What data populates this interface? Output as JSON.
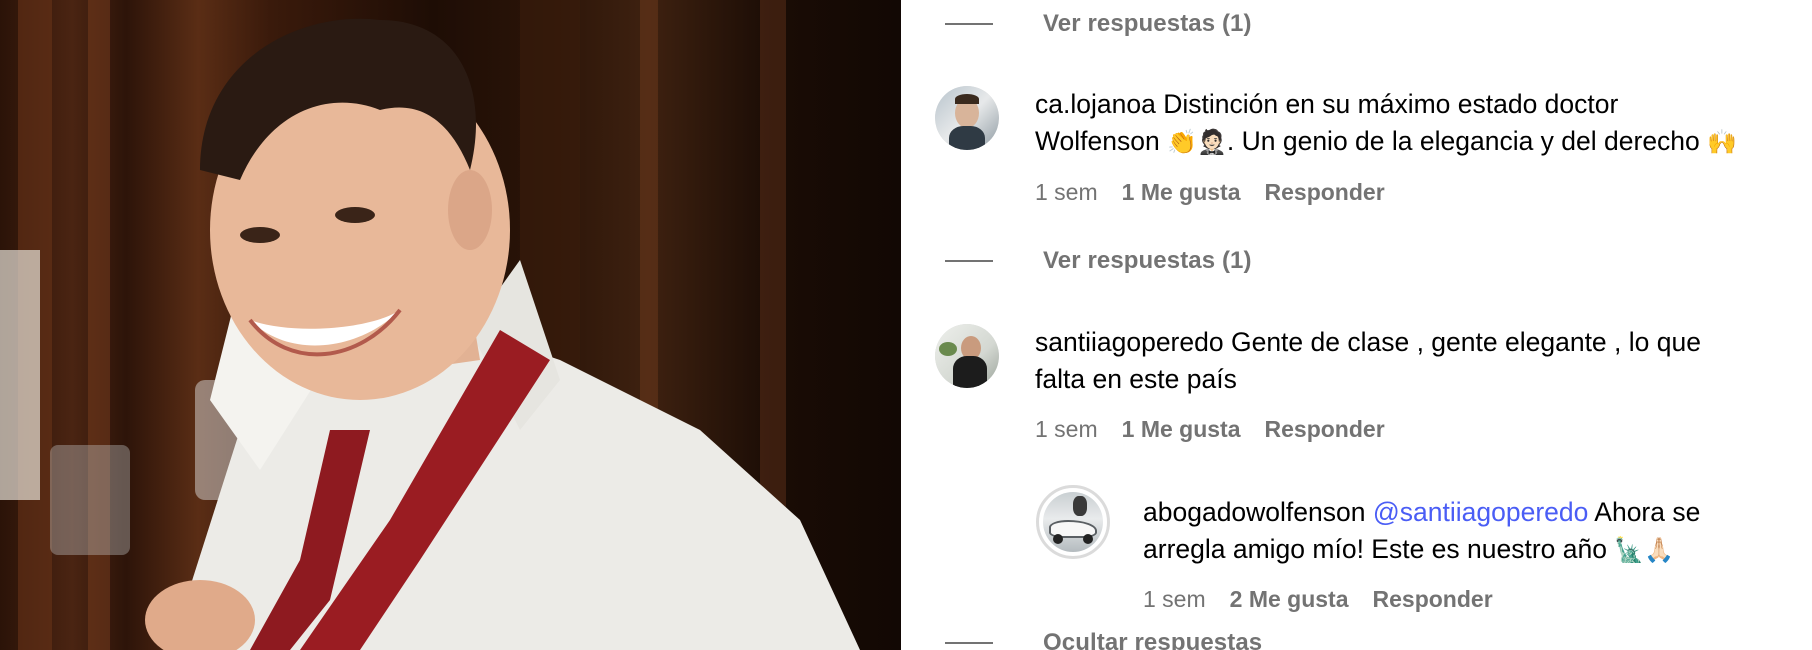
{
  "photo": {
    "alt": ""
  },
  "comments": [
    {
      "view_replies_label": "Ver respuestas (1)"
    },
    {
      "username": "ca.lojanoa",
      "text": "Distinción en su máximo estado doctor Wolfenson 👏🤵🏻. Un genio de la elegancia y del derecho 🙌",
      "text_line1": "Distinción en su máximo estado doctor",
      "text_line2_a": "Wolfenson",
      "emoji1": "👏🤵🏻",
      "text_line2_b": ". Un genio de la elegancia y del derecho",
      "emoji2": "🙌",
      "time": "1 sem",
      "likes": "1 Me gusta",
      "reply_label": "Responder",
      "view_replies_label": "Ver respuestas (1)"
    },
    {
      "username": "santiiagoperedo",
      "text_line1": "Gente de clase , gente elegante , lo que",
      "text_line2": "falta en este país",
      "time": "1 sem",
      "likes": "1 Me gusta",
      "reply_label": "Responder",
      "reply": {
        "username": "abogadowolfenson",
        "mention": "@santiiagoperedo",
        "text_line1": "Ahora se",
        "text_line2": "arregla amigo mío! Este es nuestro año",
        "emoji": "🗽🙏🏻",
        "time": "1 sem",
        "likes": "2 Me gusta",
        "reply_label": "Responder"
      },
      "hide_replies_label": "Ocultar respuestas"
    }
  ],
  "colors": {
    "secondary_text": "#737373",
    "mention": "#4a5df5",
    "primary_text": "#000000"
  }
}
